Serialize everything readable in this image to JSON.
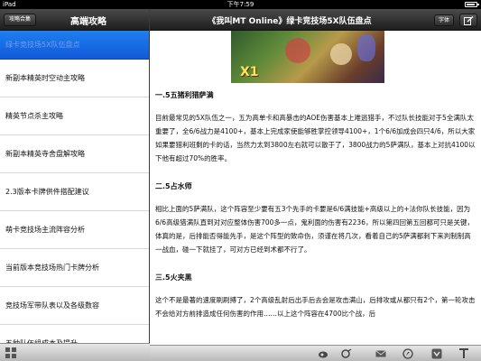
{
  "status_bar": {
    "carrier": "iPad",
    "time": "下午7:59",
    "battery_level": 0.9
  },
  "sidebar": {
    "back_label": "攻略合集",
    "title": "高端攻略",
    "items": [
      {
        "label": "绿卡竞技场5X队伍盘点",
        "selected": true
      },
      {
        "label": "新副本精英时空动主攻略",
        "selected": false
      },
      {
        "label": "精英节点杀主攻略",
        "selected": false
      },
      {
        "label": "新副本精英寺舍盘解攻略",
        "selected": false
      },
      {
        "label": "2.3版本卡牌供件搭配建议",
        "selected": false
      },
      {
        "label": "萌卡竞技场主流阵容分析",
        "selected": false
      },
      {
        "label": "当前版本竞技场热门卡牌分析",
        "selected": false
      },
      {
        "label": "竞技场军带队表以及各级数容",
        "selected": false
      },
      {
        "label": "五种队伍组成本及提升",
        "selected": false
      }
    ]
  },
  "detail": {
    "title": "《我叫MT Online》绿卡竞技场5X队伍盘点",
    "font_button_label": "字体",
    "image_caption": "X1",
    "sections": [
      {
        "heading": "一.5五猪利猎萨满",
        "body": "目前最常见的5X队伍之一，五为高单卡和高暴击的AOE伤害基本上难逃猎手，不过队长技能对于5全满队太重要了，全6/6战力是4100+，基本上完成家使能够胜掌控领导4100+，1个6/6加成会四只4/6，所以大家如果要猎利班剩的卡的话，当然力太到3800左右就可以散于了，3800战力的5萨满队，基本上对抗4100以下他有超过70%的胜率。"
      },
      {
        "heading": "二.5占水师",
        "body": "相比上面的5萨满队，这个阵容至少要有五3个先手的卡要是6/6满技能+高级以上的+法你队长技能，因为6/6高级猎满队直到对对应整体伤害700多一点，鬼利面的伤害有2236，所以第四回第五回都可只是关键，体真的是，后排能否得能先手，是这个阵型的致命伤，须谨在将几次，看着自己的5萨满都刺下来判制制高一战血，碰一下就挂了，可对方已经到术都不行了。"
      },
      {
        "heading": "三.5火夹黑",
        "body": "这个不是最著的速度刷刷搏了，2个高级乱射后出手后去会是攻击满山，后排攻或从都只有2个，第一轮攻击不会给对方前排造成任何伤害的作用……以上这个阵容在4700比个战，后"
      }
    ]
  },
  "toolbar": {
    "icons": [
      "weibo-icon",
      "sina-share-icon",
      "mail-icon",
      "safari-icon",
      "bookmark-icon",
      "font-size-icon"
    ]
  }
}
